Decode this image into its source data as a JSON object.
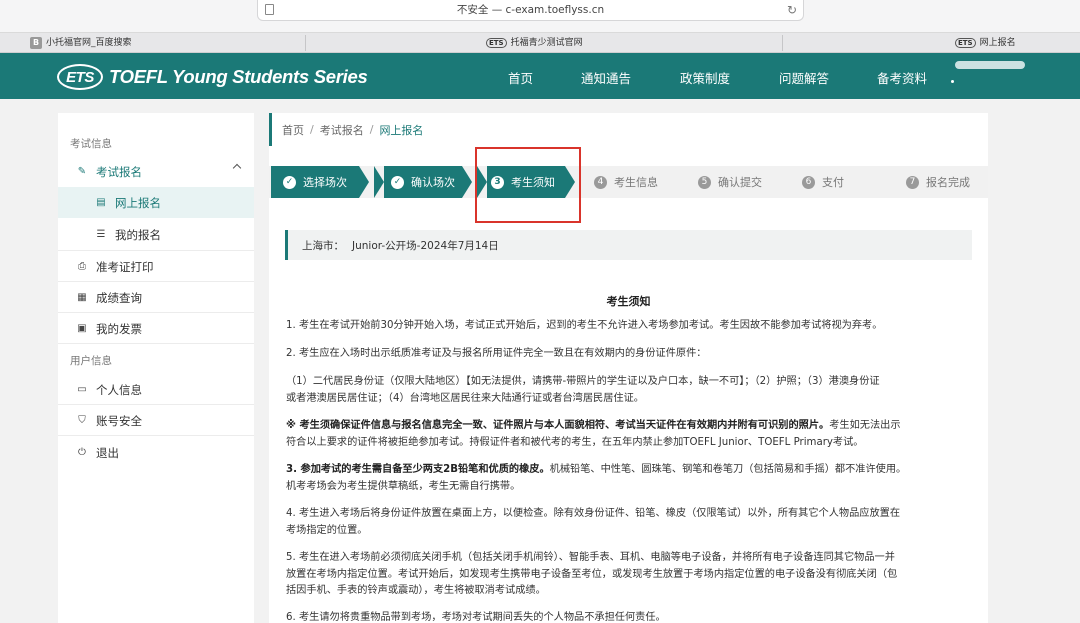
{
  "browser": {
    "url": "不安全 — c-exam.toeflyss.cn",
    "tabs": [
      {
        "favicon": "B",
        "label": "小托福官网_百度搜索"
      },
      {
        "favicon": "ETS",
        "label": "托福青少测试官网"
      },
      {
        "favicon": "ETS",
        "label": "网上报名"
      }
    ]
  },
  "header": {
    "logo_mark": "ETS",
    "logo_text": "TOEFL Young Students Series",
    "nav": [
      "首页",
      "通知通告",
      "政策制度",
      "问题解答",
      "备考资料"
    ]
  },
  "sidebar": {
    "section1": "考试信息",
    "section2": "用户信息",
    "items": [
      {
        "label": "考试报名",
        "icon": "edit-icon"
      },
      {
        "label": "网上报名",
        "icon": "form-icon"
      },
      {
        "label": "我的报名",
        "icon": "list-icon"
      },
      {
        "label": "准考证打印",
        "icon": "printer-icon"
      },
      {
        "label": "成绩查询",
        "icon": "score-icon"
      },
      {
        "label": "我的发票",
        "icon": "invoice-icon"
      },
      {
        "label": "个人信息",
        "icon": "id-card-icon"
      },
      {
        "label": "账号安全",
        "icon": "shield-icon"
      },
      {
        "label": "退出",
        "icon": "logout-icon"
      }
    ]
  },
  "breadcrumb": [
    "首页",
    "考试报名",
    "网上报名"
  ],
  "steps": [
    {
      "num": "✓",
      "label": "选择场次",
      "state": "done"
    },
    {
      "num": "✓",
      "label": "确认场次",
      "state": "done"
    },
    {
      "num": "3",
      "label": "考生须知",
      "state": "current"
    },
    {
      "num": "4",
      "label": "考生信息",
      "state": "todo"
    },
    {
      "num": "5",
      "label": "确认提交",
      "state": "todo"
    },
    {
      "num": "6",
      "label": "支付",
      "state": "todo"
    },
    {
      "num": "7",
      "label": "报名完成",
      "state": "todo"
    }
  ],
  "exam": {
    "city": "上海市：",
    "session": "Junior-公开场-2024年7月14日"
  },
  "notice": {
    "title": "考生须知",
    "p1": "1. 考生在考试开始前30分钟开始入场，考试正式开始后，迟到的考生不允许进入考场参加考试。考生因故不能参加考试将视为弃考。",
    "p2": "2. 考生应在入场时出示纸质准考证及与报名所用证件完全一致且在有效期内的身份证件原件：",
    "p3a": "（1）二代居民身份证（仅限大陆地区）【如无法提供，请携带-带照片的学生证以及户口本，缺一不可】；（2）护照；（3）港澳身份证",
    "p3b": "或者港澳居民居住证；（4）台湾地区居民往来大陆通行证或者台湾居民居住证。",
    "p4_bold": "※ 考生须确保证件信息与报名信息完全一致、证件照片与本人面貌相符、考试当天证件在有效期内并附有可识别的照片。",
    "p4a": "考生如无法出示",
    "p4b": "符合以上要求的证件将被拒绝参加考试。持假证件者和被代考的考生，在五年内禁止参加TOEFL Junior、TOEFL Primary考试。",
    "p5_bold": "3. 参加考试的考生需自备至少两支2B铅笔和优质的橡皮。",
    "p5a": "机械铅笔、中性笔、圆珠笔、钢笔和卷笔刀（包括简易和手摇）都不准许使用。",
    "p5b": "机考考场会为考生提供草稿纸，考生无需自行携带。",
    "p6a": "4. 考生进入考场后将身份证件放置在桌面上方，以便检查。除有效身份证件、铅笔、橡皮（仅限笔试）以外，所有其它个人物品应放置在",
    "p6b": "考场指定的位置。",
    "p7a": "5. 考生在进入考场前必须彻底关闭手机（包括关闭手机闹铃）、智能手表、耳机、电脑等电子设备，并将所有电子设备连同其它物品一并",
    "p7b": "放置在考场内指定位置。考试开始后，如发现考生携带电子设备至考位，或发现考生放置于考场内指定位置的电子设备没有彻底关闭（包",
    "p7c": "括因手机、手表的铃声或震动），考生将被取消考试成绩。",
    "p8": "6. 考生请勿将贵重物品带到考场，考场对考试期间丢失的个人物品不承担任何责任。"
  }
}
